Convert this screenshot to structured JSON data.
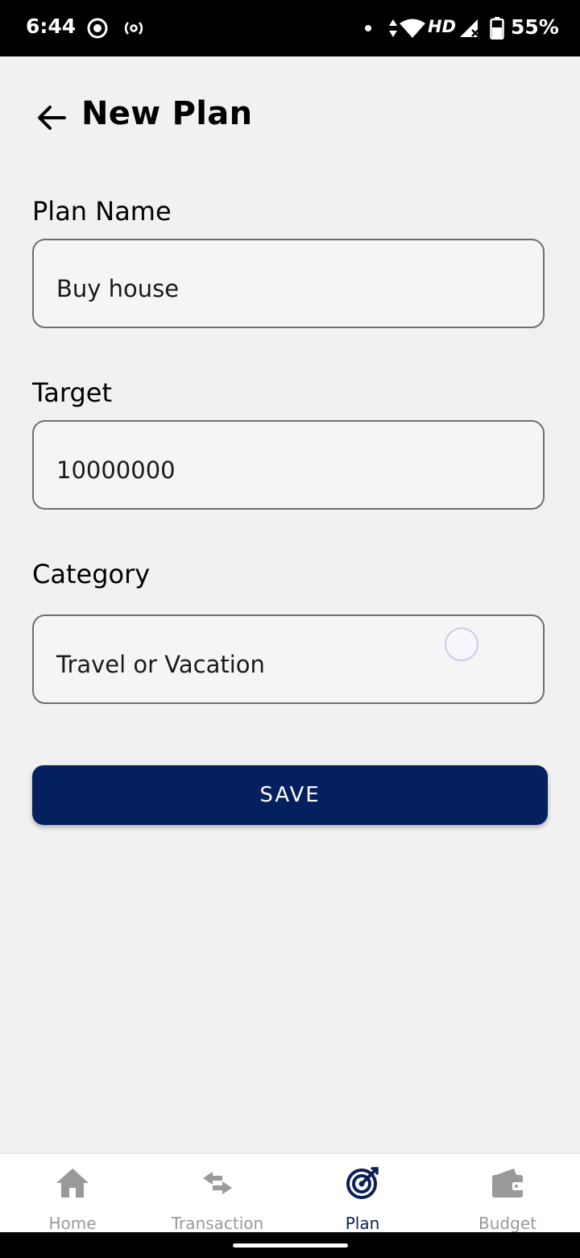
{
  "status_bar": {
    "time": "6:44",
    "network": "HD",
    "battery": "55%",
    "icons": [
      "screen-record-icon",
      "hotspot-icon",
      "notification-dot-icon",
      "data-arrows-icon",
      "wifi-icon",
      "cell-signal-icon",
      "battery-icon"
    ]
  },
  "header": {
    "title": "New Plan",
    "back_icon": "arrow-left-icon"
  },
  "form": {
    "plan_name": {
      "label": "Plan Name",
      "value": "Buy house"
    },
    "target": {
      "label": "Target",
      "value": "10000000"
    },
    "category": {
      "label": "Category",
      "value": "Travel or Vacation"
    },
    "save_label": "SAVE"
  },
  "bottom_nav": {
    "items": [
      {
        "label": "Home",
        "icon": "home-icon"
      },
      {
        "label": "Transaction",
        "icon": "swap-arrows-icon"
      },
      {
        "label": "Plan",
        "icon": "target-icon",
        "active": true
      },
      {
        "label": "Budget",
        "icon": "wallet-icon"
      }
    ]
  },
  "colors": {
    "primary": "#04205e",
    "background": "#f1f1f1",
    "nav_inactive": "#999999",
    "nav_active": "#0a2158"
  }
}
